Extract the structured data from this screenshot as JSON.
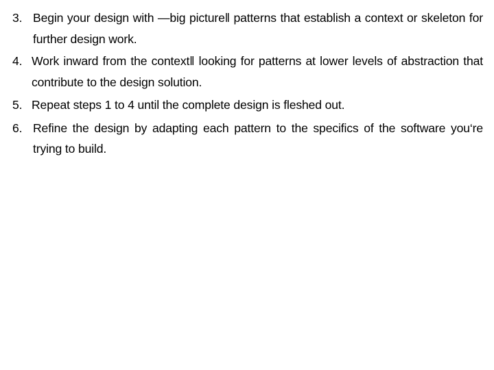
{
  "page": {
    "background_color": "#ffffff",
    "text_color": "#000000"
  },
  "list": {
    "items": [
      {
        "marker": "3.",
        "text": "Begin your design with —big picture‖ patterns that establish a context or skeleton for further design work.",
        "justified": true
      },
      {
        "marker": "4.",
        "text": "Work inward from the context‖ looking for patterns at lower levels of abstraction that contribute to the design solution.",
        "justified": true
      },
      {
        "marker": "5.",
        "text": "Repeat steps 1 to 4 until the complete design is fleshed out.",
        "justified": false
      },
      {
        "marker": "6.",
        "text": "Refine the design by adapting each pattern to the specifics of the software you‘re trying to build.",
        "justified": true
      }
    ]
  }
}
